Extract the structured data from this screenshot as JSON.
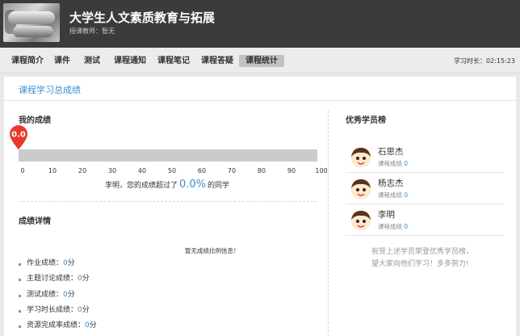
{
  "header": {
    "course_title": "大学生人文素质教育与拓展",
    "teacher": "授课教师：暂无"
  },
  "nav": {
    "items": [
      "课程简介",
      "课件",
      "测试",
      "课程通知",
      "课程笔记",
      "课程答疑",
      "课程统计"
    ],
    "active_index": 6,
    "study_time": "学习时长：02:15:23"
  },
  "panel": {
    "title": "课程学习总成绩"
  },
  "my_score": {
    "title": "我的成绩",
    "value": "0.0",
    "progress_percent": 0,
    "ticks": [
      "0",
      "10",
      "20",
      "30",
      "40",
      "50",
      "60",
      "70",
      "80",
      "90",
      "100"
    ],
    "exceed_prefix": "李明，您的成绩超过了",
    "exceed_pct": "0.0%",
    "exceed_suffix": "的同学"
  },
  "details": {
    "title": "成绩详情",
    "no_ratio": "暂无成绩比例信息！",
    "items": [
      {
        "label": "作业成绩：",
        "value": "0",
        "unit": "分"
      },
      {
        "label": "主题讨论成绩：",
        "value": "0",
        "unit": "分"
      },
      {
        "label": "测试成绩：",
        "value": "0",
        "unit": "分"
      },
      {
        "label": "学习时长成绩：",
        "value": "0",
        "unit": "分"
      },
      {
        "label": "资源完成率成绩：",
        "value": "0",
        "unit": "分"
      }
    ]
  },
  "ranking": {
    "title": "优秀学员榜",
    "score_label": "课程成绩",
    "students": [
      {
        "name": "石思杰",
        "score": "0"
      },
      {
        "name": "杨志杰",
        "score": "0"
      },
      {
        "name": "李明",
        "score": "0"
      }
    ],
    "congrats_line1": "祝贺上述学员荣登优秀学员榜，",
    "congrats_line2": "望大家向他们学习！多多努力!"
  },
  "colors": {
    "accent": "#3a8fd0",
    "pin": "#e8392b",
    "header_bg": "#3b3b3b"
  }
}
